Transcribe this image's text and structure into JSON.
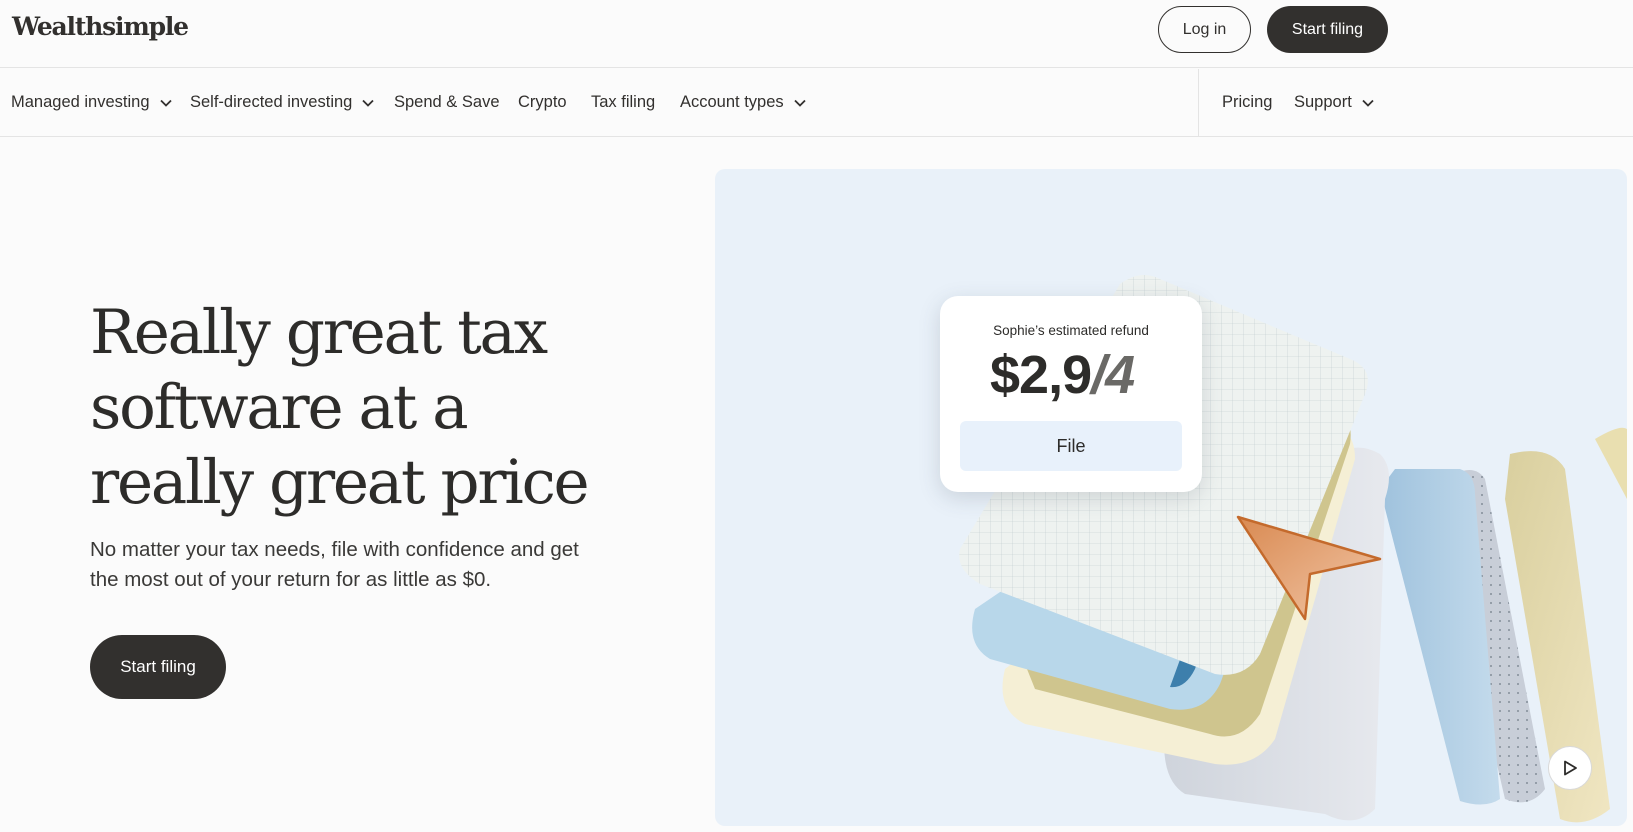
{
  "brand": {
    "logo_text": "Wealthsimple"
  },
  "header": {
    "login_label": "Log in",
    "start_filing_label": "Start filing"
  },
  "nav": {
    "items": [
      {
        "label": "Managed investing",
        "has_dropdown": true
      },
      {
        "label": "Self-directed investing",
        "has_dropdown": true
      },
      {
        "label": "Spend & Save",
        "has_dropdown": false
      },
      {
        "label": "Crypto",
        "has_dropdown": false
      },
      {
        "label": "Tax filing",
        "has_dropdown": false
      },
      {
        "label": "Account types",
        "has_dropdown": true
      }
    ],
    "right_items": [
      {
        "label": "Pricing",
        "has_dropdown": false
      },
      {
        "label": "Support",
        "has_dropdown": true
      }
    ]
  },
  "hero": {
    "headline_line1": "Really great tax",
    "headline_line2": "software at a",
    "headline_line3": "really great price",
    "subtext": "No matter your tax needs, file with confidence and get the most out of your return for as little as $0.",
    "cta_label": "Start filing"
  },
  "media": {
    "card_title": "Sophie’s estimated refund",
    "amount_visible": "$2,9",
    "amount_ghost": "/4",
    "file_button_label": "File",
    "play_icon": "play-icon"
  },
  "colors": {
    "primary_dark": "#32302e",
    "media_background": "#e9f1f9",
    "file_button_bg": "#e8f1fb"
  }
}
